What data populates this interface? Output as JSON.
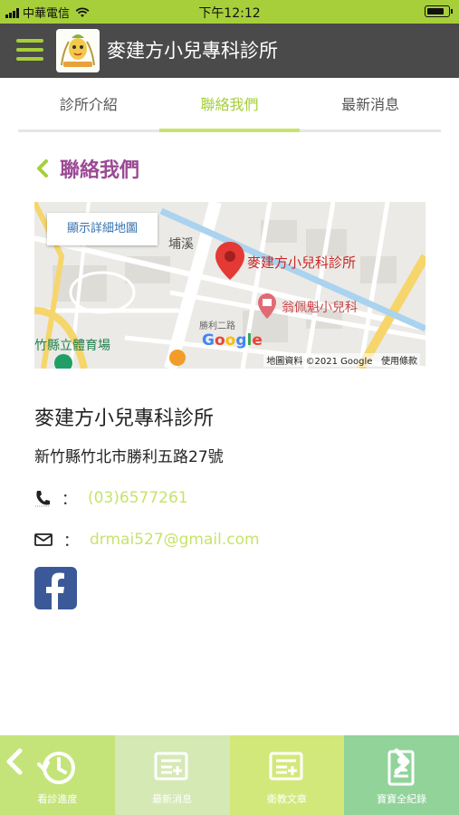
{
  "status_bar": {
    "carrier": "中華電信",
    "time": "下午12:12",
    "battery_level": 0.85
  },
  "app_bar": {
    "title": "麥建方小兒專科診所"
  },
  "tabs": [
    {
      "label": "診所介紹",
      "active": false
    },
    {
      "label": "聯絡我們",
      "active": true
    },
    {
      "label": "最新消息",
      "active": false
    }
  ],
  "section": {
    "title": "聯絡我們"
  },
  "map": {
    "show_detail_button": "顯示詳細地圖",
    "pin_label": "麥建方小兒科診所",
    "other_label": "翁佩魁小兒科",
    "google_label": "Google",
    "attribution": "地圖資料 ©2021 Google",
    "terms": "使用條款",
    "road_label_1": "埔溪",
    "road_label_2": "勝利二路",
    "venue_label": "竹縣立體育場"
  },
  "clinic": {
    "name": "麥建方小兒專科診所",
    "address": "新竹縣竹北市勝利五路27號",
    "phone": "(03)6577261",
    "email": "drmai527@gmail.com",
    "separator": "："
  },
  "bottom_nav": [
    {
      "label": "看診進度",
      "icon": "clock-history-icon",
      "color": "#c4e47a"
    },
    {
      "label": "最新消息",
      "icon": "newspaper-icon",
      "color": "#d5e9b4"
    },
    {
      "label": "衛教文章",
      "icon": "newspaper-icon",
      "color": "#d3e87a"
    },
    {
      "label": "寶寶全紀錄",
      "icon": "baby-record-icon",
      "color": "#92d39a"
    }
  ],
  "colors": {
    "accent": "#a6cf39",
    "header_bg": "#4a4a4a",
    "section_title": "#9b4a94",
    "link": "#c7e36b",
    "facebook": "#3b5998"
  }
}
